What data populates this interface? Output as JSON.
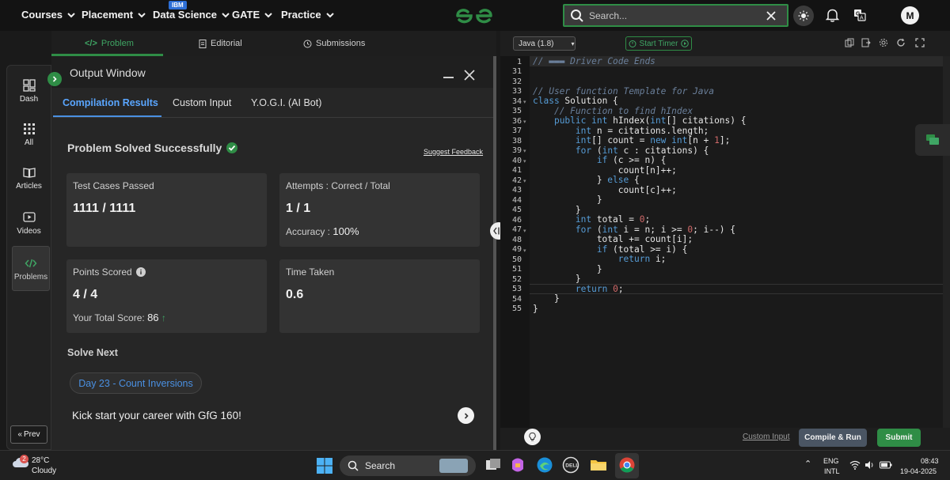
{
  "nav": {
    "items": [
      {
        "label": "Courses"
      },
      {
        "label": "Placement"
      },
      {
        "label": "Data Science",
        "badge": "IBM"
      },
      {
        "label": "GATE"
      },
      {
        "label": "Practice"
      }
    ],
    "search_placeholder": "Search...",
    "avatar_initial": "M"
  },
  "sidebar": {
    "items": [
      {
        "label": "Dash",
        "icon": "dashboard-icon"
      },
      {
        "label": "All",
        "icon": "grid-icon"
      },
      {
        "label": "Articles",
        "icon": "book-icon"
      },
      {
        "label": "Videos",
        "icon": "play-icon"
      },
      {
        "label": "Problems",
        "icon": "code-icon",
        "active": true
      }
    ],
    "prev_label": "Prev"
  },
  "problem_tabs": [
    {
      "label": "Problem",
      "active": true
    },
    {
      "label": "Editorial"
    },
    {
      "label": "Submissions"
    }
  ],
  "output": {
    "title": "Output Window",
    "tabs": [
      "Compilation Results",
      "Custom Input",
      "Y.O.G.I. (AI Bot)"
    ],
    "status": "Problem Solved Successfully",
    "suggest_feedback": "Suggest Feedback",
    "cards": {
      "test_cases": {
        "label": "Test Cases Passed",
        "value": "1111 / 1111"
      },
      "attempts": {
        "label": "Attempts : Correct / Total",
        "value": "1 / 1",
        "accuracy_label": "Accuracy :",
        "accuracy_value": "100%"
      },
      "points": {
        "label": "Points Scored",
        "value": "4 / 4",
        "total_label": "Your Total Score:",
        "total_value": "86"
      },
      "time": {
        "label": "Time Taken",
        "value": "0.6"
      }
    },
    "solve_next_label": "Solve Next",
    "next_problem": "Day 23 - Count Inversions",
    "kick_start": "Kick start your career with GfG 160!"
  },
  "editor": {
    "language": "Java (1.8)",
    "timer_label": "Start Timer",
    "line_numbers": [
      "1",
      "31",
      "32",
      "33",
      "34",
      "35",
      "36",
      "37",
      "38",
      "39",
      "40",
      "41",
      "42",
      "43",
      "44",
      "45",
      "46",
      "47",
      "48",
      "49",
      "50",
      "51",
      "52",
      "53",
      "54",
      "55"
    ],
    "custom_input_label": "Custom Input",
    "compile_label": "Compile & Run",
    "submit_label": "Submit"
  },
  "taskbar": {
    "temperature": "28°C",
    "weather": "Cloudy",
    "weather_badge": "2",
    "search_label": "Search",
    "language": "ENG",
    "layout": "INTL",
    "time": "08:43",
    "date": "19-04-2025"
  },
  "colors": {
    "accent_green": "#2f8d46",
    "link_blue": "#4a90e2",
    "background": "#1a1a1a"
  }
}
